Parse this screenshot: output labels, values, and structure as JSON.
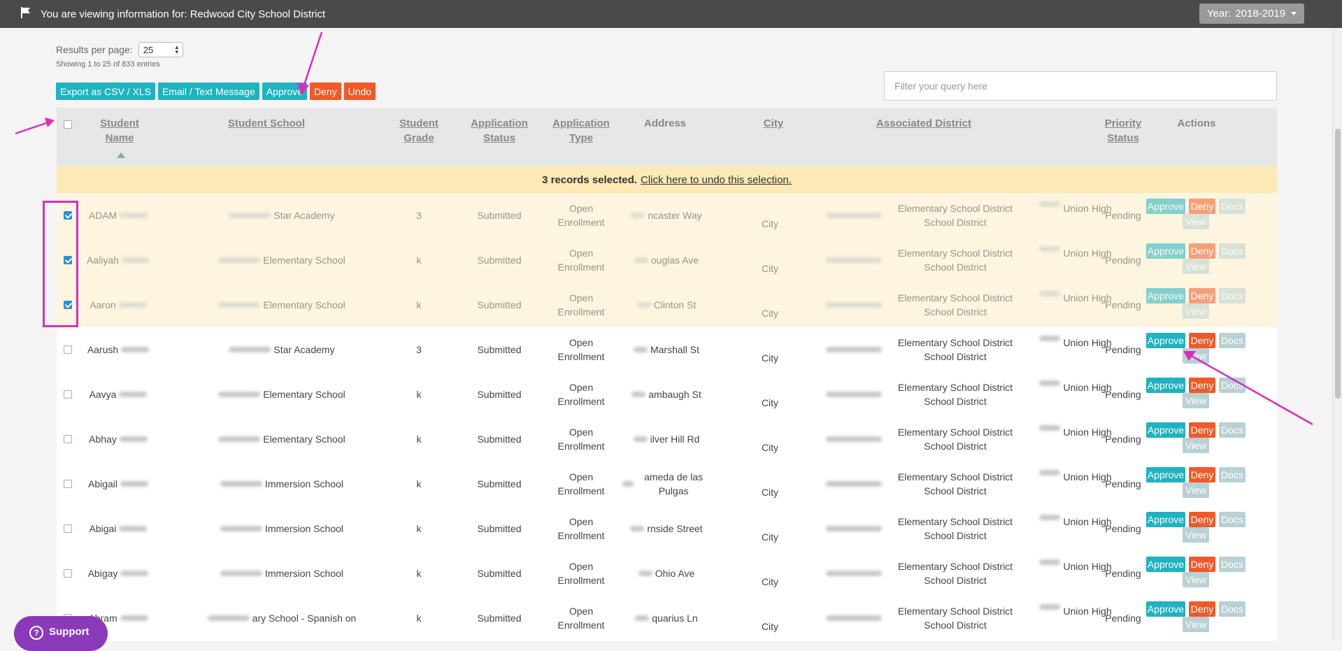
{
  "topbar": {
    "viewing_text": "You are viewing information for: Redwood City School District",
    "year_label": "Year:",
    "year_value": "2018-2019"
  },
  "controls": {
    "rpp_label": "Results per page:",
    "rpp_value": "25",
    "showing": "Showing 1 to 25 of 833 entries",
    "buttons": [
      "Export as CSV / XLS",
      "Email / Text Message",
      "Approve",
      "Deny",
      "Undo"
    ],
    "filter_placeholder": "Filter your query here"
  },
  "table": {
    "headers": {
      "student_name": "Student Name",
      "student_school": "Student School",
      "student_grade": "Student Grade",
      "application_status": "Application Status",
      "application_type": "Application Type",
      "address": "Address",
      "city": "City",
      "associated_district": "Associated District",
      "priority_status": "Priority Status",
      "actions": "Actions"
    },
    "selection_banner": {
      "bold": "3 records selected.",
      "link": "Click here to undo this selection."
    },
    "rows": [
      {
        "name": "ADAM",
        "school": "Star Academy",
        "grade": "3",
        "status": "Submitted",
        "type": "Open Enrollment",
        "address": "ncaster Way",
        "city": "City",
        "district": "Elementary School District",
        "district2": "School District",
        "district3": "Union High",
        "priority": "Pending",
        "checked": true
      },
      {
        "name": "Aaliyah",
        "school": "Elementary School",
        "grade": "k",
        "status": "Submitted",
        "type": "Open Enrollment",
        "address": "ouglas Ave",
        "city": "City",
        "district": "Elementary School District",
        "district2": "School District",
        "district3": "Union High",
        "priority": "Pending",
        "checked": true
      },
      {
        "name": "Aaron",
        "school": "Elementary School",
        "grade": "k",
        "status": "Submitted",
        "type": "Open Enrollment",
        "address": "Clinton St",
        "city": "City",
        "district": "Elementary School District",
        "district2": "School District",
        "district3": "Union High",
        "priority": "Pending",
        "checked": true
      },
      {
        "name": "Aarush",
        "school": "Star Academy",
        "grade": "3",
        "status": "Submitted",
        "type": "Open Enrollment",
        "address": "Marshall St",
        "city": "City",
        "district": "Elementary School District",
        "district2": "School District",
        "district3": "Union High",
        "priority": "Pending",
        "checked": false
      },
      {
        "name": "Aavya",
        "school": "Elementary School",
        "grade": "k",
        "status": "Submitted",
        "type": "Open Enrollment",
        "address": "ambaugh St",
        "city": "City",
        "district": "Elementary School District",
        "district2": "School District",
        "district3": "Union High",
        "priority": "Pending",
        "checked": false
      },
      {
        "name": "Abhay",
        "school": "Elementary School",
        "grade": "k",
        "status": "Submitted",
        "type": "Open Enrollment",
        "address": "ilver Hill Rd",
        "city": "City",
        "district": "Elementary School District",
        "district2": "School District",
        "district3": "Union High",
        "priority": "Pending",
        "checked": false
      },
      {
        "name": "Abigail",
        "school": "Immersion School",
        "grade": "k",
        "status": "Submitted",
        "type": "Open Enrollment",
        "address": "ameda de las Pulgas",
        "city": "City",
        "district": "Elementary School District",
        "district2": "School District",
        "district3": "Union High",
        "priority": "Pending",
        "checked": false
      },
      {
        "name": "Abigai",
        "school": "Immersion School",
        "grade": "k",
        "status": "Submitted",
        "type": "Open Enrollment",
        "address": "rnside Street",
        "city": "City",
        "district": "Elementary School District",
        "district2": "School District",
        "district3": "Union High",
        "priority": "Pending",
        "checked": false
      },
      {
        "name": "Abigay",
        "school": "Immersion School",
        "grade": "k",
        "status": "Submitted",
        "type": "Open Enrollment",
        "address": "Ohio Ave",
        "city": "City",
        "district": "Elementary School District",
        "district2": "School District",
        "district3": "Union High",
        "priority": "Pending",
        "checked": false
      },
      {
        "name": "Abram",
        "school": "ary School - Spanish on",
        "grade": "k",
        "status": "Submitted",
        "type": "Open Enrollment",
        "address": "quarius Ln",
        "city": "City",
        "district": "Elementary School District",
        "district2": "School District",
        "district3": "Union High",
        "priority": "Pending",
        "checked": false
      }
    ],
    "action_labels": {
      "approve": "Approve",
      "deny": "Deny",
      "docs": "Docs",
      "view": "View"
    }
  },
  "support": {
    "label": "Support"
  },
  "colors": {
    "teal": "#1fb3bf",
    "orange": "#ef5a28",
    "annotation": "#d62fb8"
  }
}
